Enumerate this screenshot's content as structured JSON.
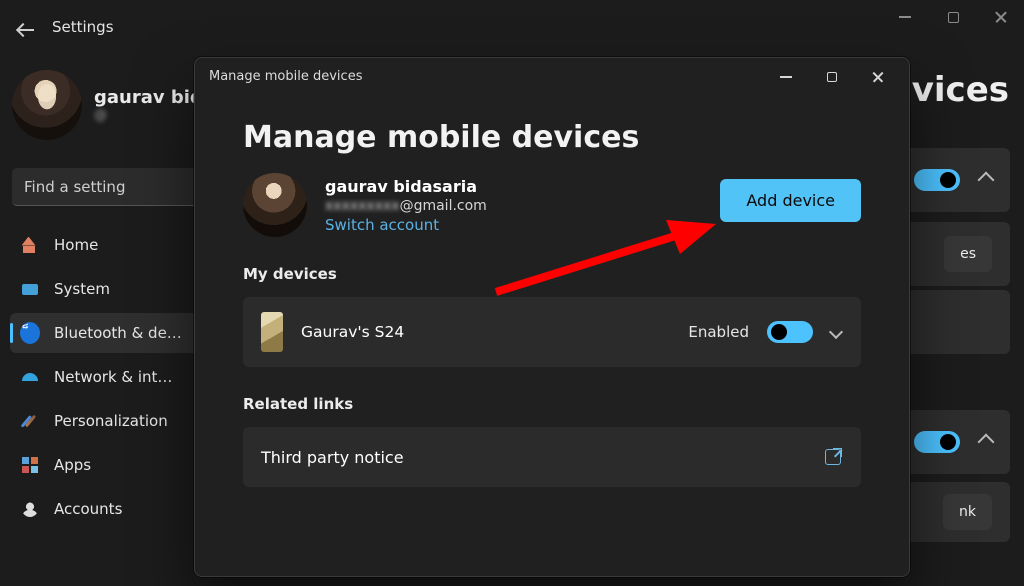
{
  "outerWindow": {
    "title": "Settings",
    "user": {
      "name": "gaurav bid",
      "emailPrefix": "@"
    },
    "searchPlaceholder": "Find a setting",
    "sidebar": [
      {
        "id": "home",
        "label": "Home"
      },
      {
        "id": "system",
        "label": "System"
      },
      {
        "id": "bluetooth",
        "label": "Bluetooth & de…",
        "selected": true
      },
      {
        "id": "network",
        "label": "Network & int…"
      },
      {
        "id": "personal",
        "label": "Personalization"
      },
      {
        "id": "apps",
        "label": "Apps"
      },
      {
        "id": "accounts",
        "label": "Accounts"
      }
    ],
    "rightHeadingFragment": "evices",
    "bgRowLinkLabel": "nk",
    "bgRowLinkLabel2": "es"
  },
  "dialog": {
    "windowTitle": "Manage mobile devices",
    "heading": "Manage mobile devices",
    "account": {
      "name": "gaurav bidasaria",
      "emailSuffix": "@gmail.com",
      "switchLabel": "Switch account"
    },
    "addDeviceLabel": "Add device",
    "sections": {
      "myDevices": "My devices",
      "relatedLinks": "Related links"
    },
    "device": {
      "name": "Gaurav's S24",
      "statusLabel": "Enabled",
      "enabled": true
    },
    "thirdParty": "Third party notice"
  }
}
